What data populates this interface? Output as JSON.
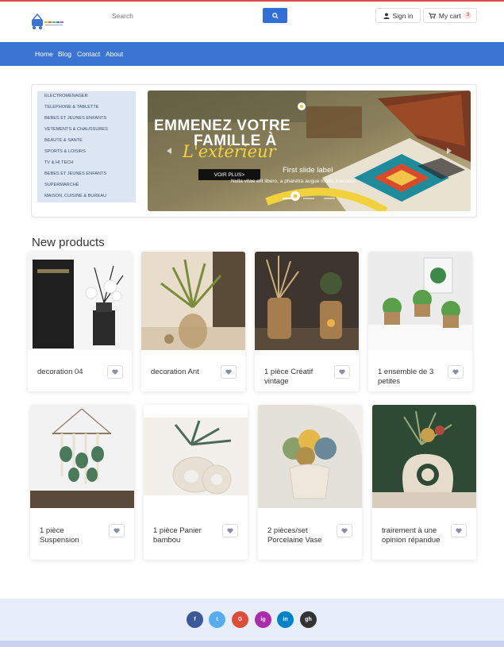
{
  "header": {
    "search_placeholder": "Search",
    "signin_label": "Sign in",
    "cart_label": "My cart",
    "cart_count": "3"
  },
  "nav": {
    "items": [
      "Home",
      "Blog",
      "Contact",
      "About"
    ]
  },
  "categories": [
    "ELECTROMENAGER",
    "TELEPHONE & TABLETTE",
    "BEBES ET JEUNES ENFANTS",
    "VETEMENTS & CHAUSSURES",
    "BEAUTE & SANTE",
    "SPORTS & LOISIRS",
    "TV & HI TECH",
    "BEBES ET JEUNES ENFANTS",
    "SUPERMARCHÉ",
    "MAISON, CUISINE & BUREAU"
  ],
  "banner": {
    "headline1": "EMMENEZ VOTRE",
    "headline2": "FAMILLE À",
    "script": "L'extérieur",
    "cta": "VOIR PLUS>",
    "slide_label": "First slide label",
    "slide_text": "Nulla vitae elit libero, a pharetra augue mollis interdum."
  },
  "section_title": "New products",
  "products": [
    {
      "title": "decoration 04"
    },
    {
      "title": "decoration Ant"
    },
    {
      "title": "1 pièce Créatif vintage"
    },
    {
      "title": "1 ensemble de 3 petites"
    },
    {
      "title": "1 pièce Suspension"
    },
    {
      "title": "1 pièce Panier bambou"
    },
    {
      "title": "2 pièces/set Porcelaine Vase"
    },
    {
      "title": "trairement à une opinion répandue"
    }
  ],
  "social": [
    "f",
    "t",
    "G",
    "ig",
    "in",
    "gh"
  ],
  "colors": {
    "primary": "#3b74d3",
    "search_button": "#2f6fd6",
    "category_bg": "#dde6f4",
    "footer_bg": "#e8eef9"
  }
}
